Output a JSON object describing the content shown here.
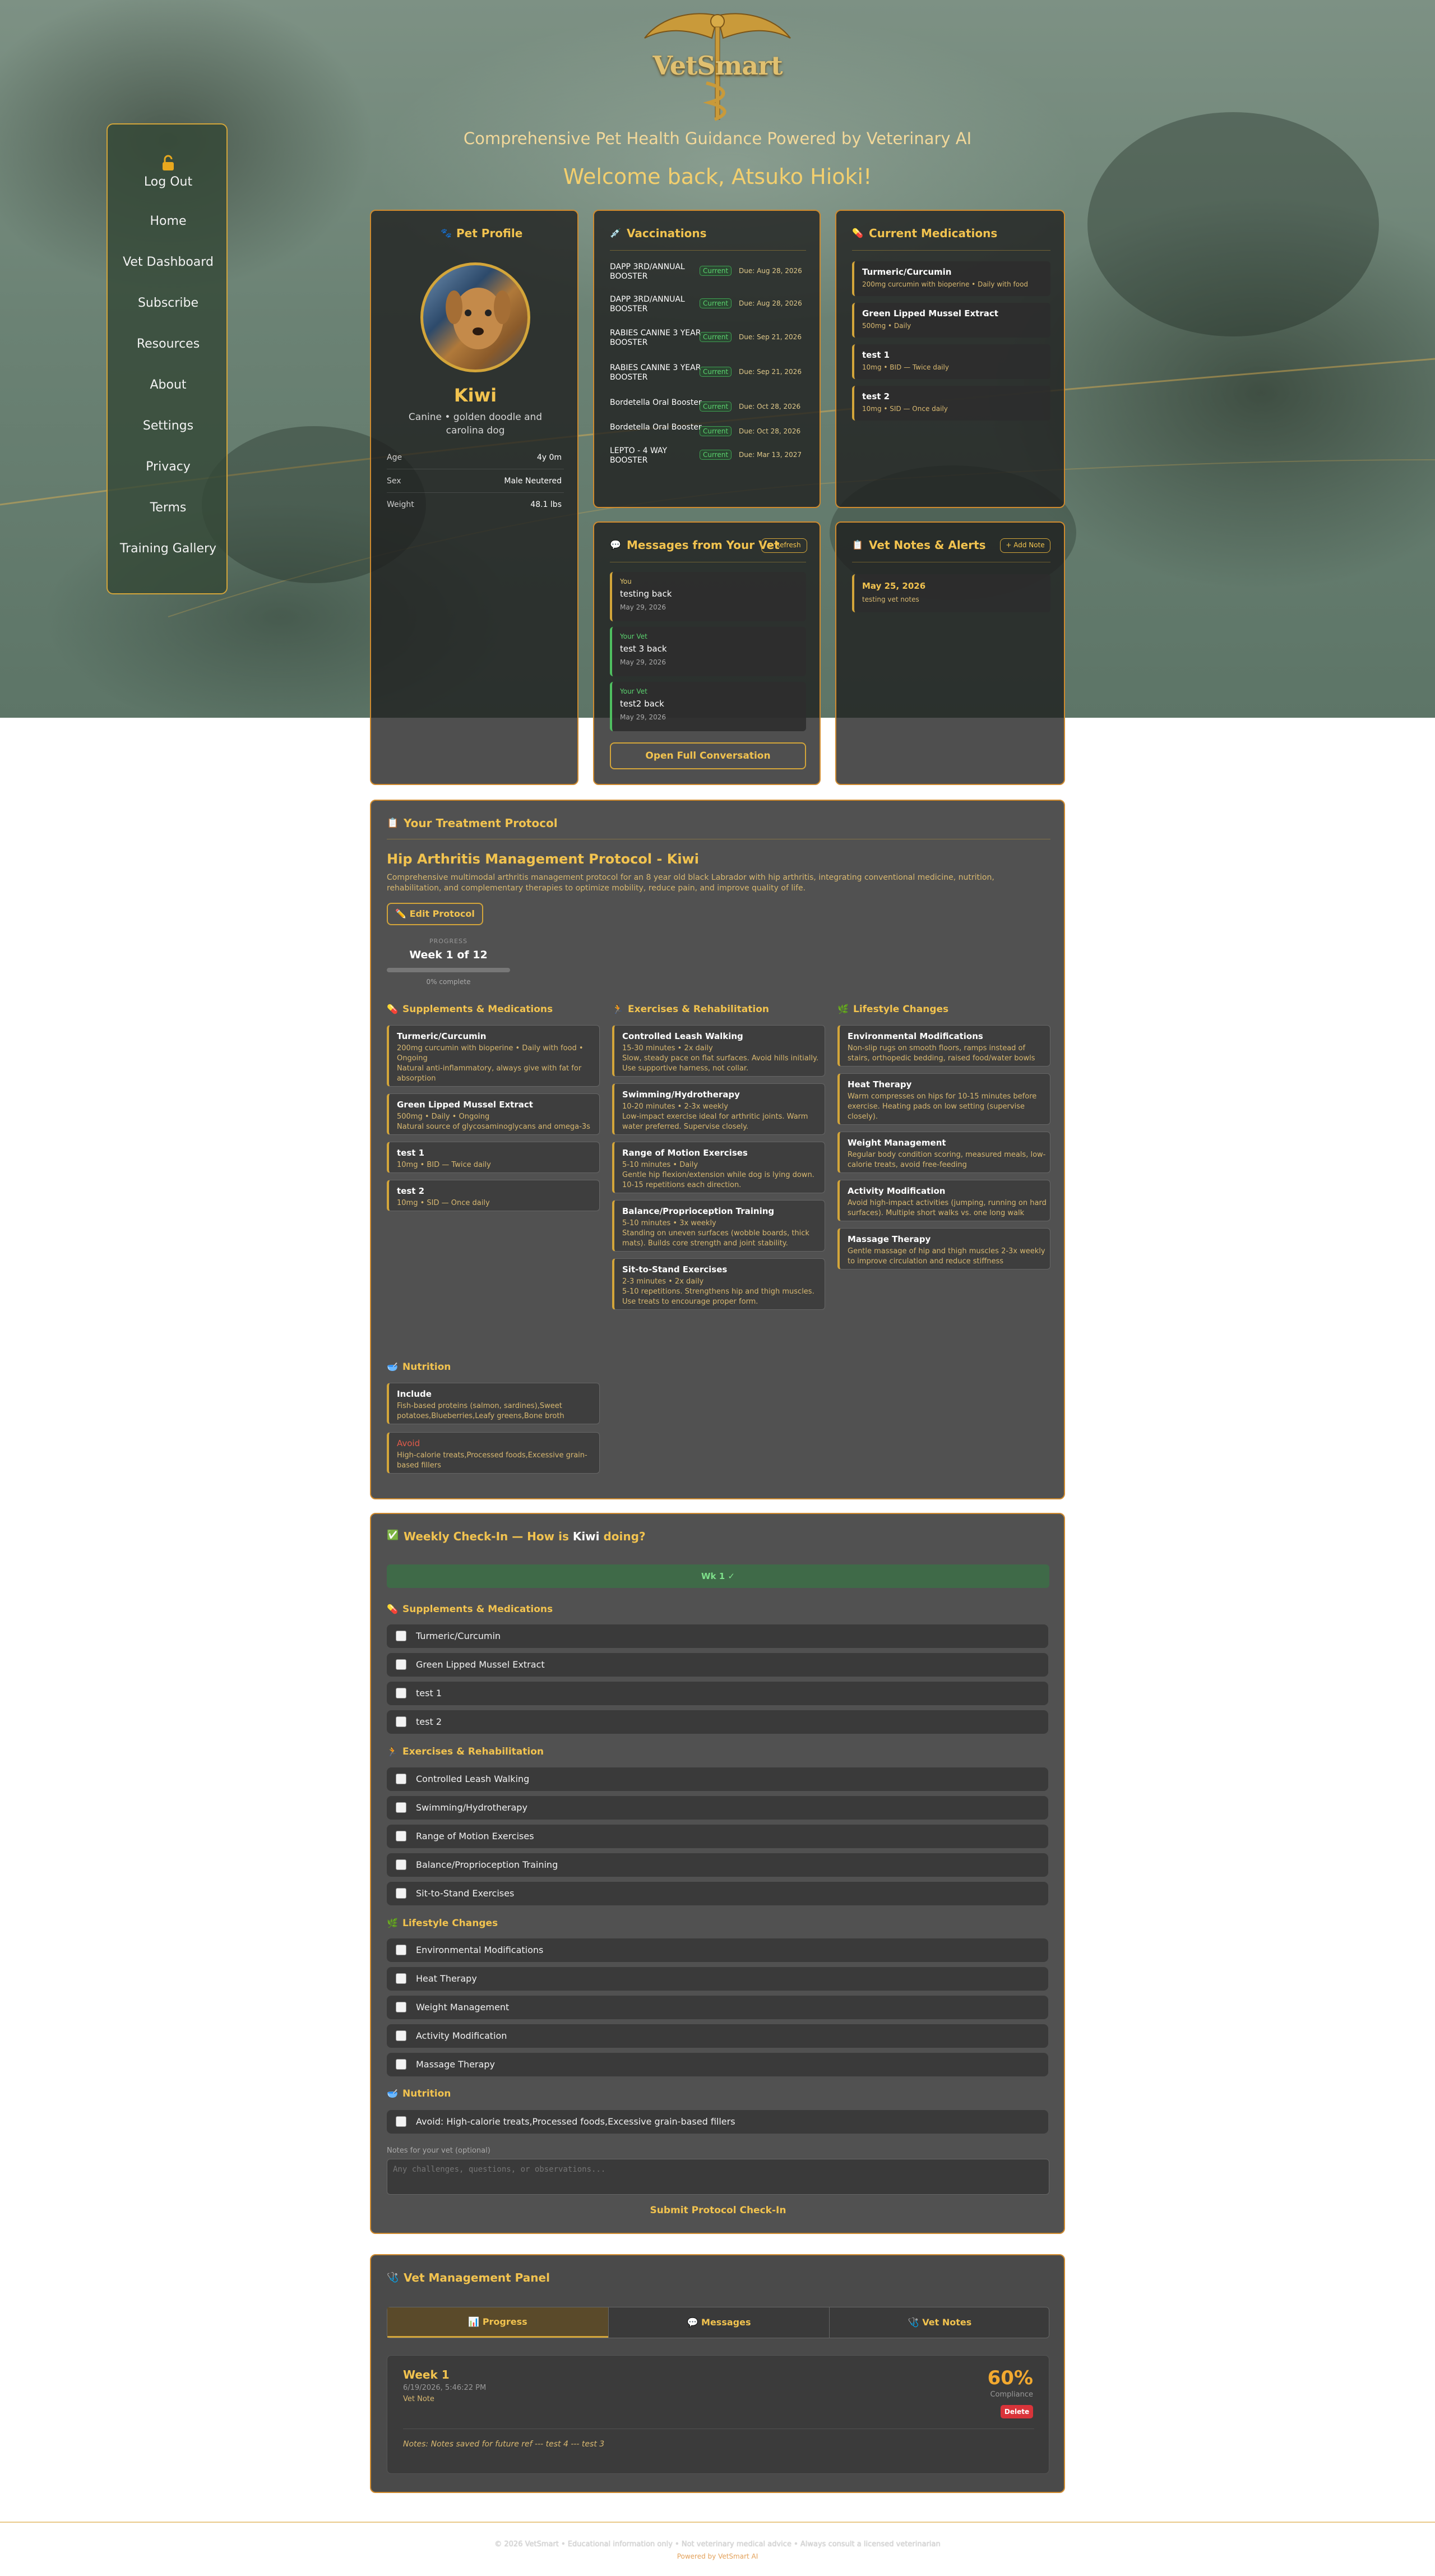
{
  "brand": {
    "name": "VetSmart",
    "tagline": "Comprehensive Pet Health Guidance Powered by Veterinary AI",
    "welcome": "Welcome back, Atsuko Hioki!"
  },
  "colors": {
    "gold": "#d3a53a",
    "card": "#515151",
    "green": "#4fbf60",
    "red": "#d9343a"
  },
  "sidebar": {
    "logout": "Log Out",
    "items": [
      "Home",
      "Vet Dashboard",
      "Subscribe",
      "Resources",
      "About",
      "Settings",
      "Privacy",
      "Terms",
      "Training Gallery"
    ]
  },
  "pet": {
    "heading": "Pet Profile",
    "name": "Kiwi",
    "breed": "Canine • golden doodle and carolina dog",
    "stats": [
      {
        "label": "Age",
        "value": "4y 0m"
      },
      {
        "label": "Sex",
        "value": "Male Neutered"
      },
      {
        "label": "Weight",
        "value": "48.1 lbs"
      }
    ]
  },
  "vaccinations": {
    "heading": "Vaccinations",
    "items": [
      {
        "name": "DAPP 3RD/ANNUAL BOOSTER",
        "status": "Current",
        "due": "Due: Aug 28, 2026"
      },
      {
        "name": "DAPP 3RD/ANNUAL BOOSTER",
        "status": "Current",
        "due": "Due: Aug 28, 2026"
      },
      {
        "name": "RABIES CANINE 3 YEAR BOOSTER",
        "status": "Current",
        "due": "Due: Sep 21, 2026"
      },
      {
        "name": "RABIES CANINE 3 YEAR BOOSTER",
        "status": "Current",
        "due": "Due: Sep 21, 2026"
      },
      {
        "name": "Bordetella Oral Booster",
        "status": "Current",
        "due": "Due: Oct 28, 2026"
      },
      {
        "name": "Bordetella Oral Booster",
        "status": "Current",
        "due": "Due: Oct 28, 2026"
      },
      {
        "name": "LEPTO - 4 WAY BOOSTER",
        "status": "Current",
        "due": "Due: Mar 13, 2027"
      }
    ]
  },
  "medications": {
    "heading": "Current Medications",
    "items": [
      {
        "name": "Turmeric/Curcumin",
        "detail": "200mg curcumin with bioperine • Daily with food"
      },
      {
        "name": "Green Lipped Mussel Extract",
        "detail": "500mg • Daily"
      },
      {
        "name": "test 1",
        "detail": "10mg • BID — Twice daily"
      },
      {
        "name": "test 2",
        "detail": "10mg • SID — Once daily"
      }
    ]
  },
  "messages": {
    "heading": "Messages from Your Vet",
    "refresh": "↻ Refresh",
    "open": "Open Full Conversation",
    "items": [
      {
        "from": "You",
        "text": "testing back",
        "date": "May 29, 2026"
      },
      {
        "from": "Your Vet",
        "text": "test 3 back",
        "date": "May 29, 2026"
      },
      {
        "from": "Your Vet",
        "text": "test2 back",
        "date": "May 29, 2026"
      }
    ]
  },
  "notes": {
    "heading": "Vet Notes & Alerts",
    "add": "+ Add Note",
    "items": [
      {
        "date": "May 25, 2026",
        "text": "testing vet notes"
      }
    ]
  },
  "protocol": {
    "heading": "Your Treatment Protocol",
    "title": "Hip Arthritis Management Protocol - Kiwi",
    "desc": "Comprehensive multimodal arthritis management protocol for an 8 year old black Labrador with hip arthritis, integrating conventional medicine, nutrition, rehabilitation, and complementary therapies to optimize mobility, reduce pain, and improve quality of life.",
    "edit": "Edit Protocol",
    "progress_label": "PROGRESS",
    "week": "Week 1 of 12",
    "complete": "0% complete",
    "progress_fraction": 0,
    "supp_h": "Supplements & Medications",
    "ex_h": "Exercises & Rehabilitation",
    "life_h": "Lifestyle Changes",
    "nut_h": "Nutrition",
    "supplements": [
      {
        "t": "Turmeric/Curcumin",
        "s": [
          "200mg curcumin with bioperine • Daily with food •",
          "Ongoing",
          "Natural anti-inflammatory, always give with fat for",
          "absorption"
        ]
      },
      {
        "t": "Green Lipped Mussel Extract",
        "s": [
          "500mg • Daily • Ongoing",
          "Natural source of glycosaminoglycans and omega-3s"
        ]
      },
      {
        "t": "test 1",
        "s": [
          "10mg • BID — Twice daily"
        ]
      },
      {
        "t": "test 2",
        "s": [
          "10mg • SID — Once daily"
        ]
      }
    ],
    "exercises": [
      {
        "t": "Controlled Leash Walking",
        "s": [
          "15-30 minutes • 2x daily",
          "Slow, steady pace on flat surfaces. Avoid hills initially.",
          "Use supportive harness, not collar."
        ]
      },
      {
        "t": "Swimming/Hydrotherapy",
        "s": [
          "10-20 minutes • 2-3x weekly",
          "Low-impact exercise ideal for arthritic joints. Warm",
          "water preferred. Supervise closely."
        ]
      },
      {
        "t": "Range of Motion Exercises",
        "s": [
          "5-10 minutes • Daily",
          "Gentle hip flexion/extension while dog is lying down.",
          "10-15 repetitions each direction."
        ]
      },
      {
        "t": "Balance/Proprioception Training",
        "s": [
          "5-10 minutes • 3x weekly",
          "Standing on uneven surfaces (wobble boards, thick",
          "mats). Builds core strength and joint stability."
        ]
      },
      {
        "t": "Sit-to-Stand Exercises",
        "s": [
          "2-3 minutes • 2x daily",
          "5-10 repetitions. Strengthens hip and thigh muscles.",
          "Use treats to encourage proper form."
        ]
      }
    ],
    "lifestyle": [
      {
        "t": "Environmental Modifications",
        "s": [
          "Non-slip rugs on smooth floors, ramps instead of",
          "stairs, orthopedic bedding, raised food/water bowls"
        ]
      },
      {
        "t": "Heat Therapy",
        "s": [
          "Warm compresses on hips for 10-15 minutes before",
          "exercise. Heating pads on low setting (supervise",
          "closely)."
        ]
      },
      {
        "t": "Weight Management",
        "s": [
          "Regular body condition scoring, measured meals, low-",
          "calorie treats, avoid free-feeding"
        ]
      },
      {
        "t": "Activity Modification",
        "s": [
          "Avoid high-impact activities (jumping, running on hard",
          "surfaces). Multiple short walks vs. one long walk"
        ]
      },
      {
        "t": "Massage Therapy",
        "s": [
          "Gentle massage of hip and thigh muscles 2-3x weekly",
          "to improve circulation and reduce stiffness"
        ]
      }
    ],
    "nutrition": [
      {
        "t": "Include",
        "s": [
          "Fish-based proteins (salmon, sardines),Sweet",
          "potatoes,Blueberries,Leafy greens,Bone broth"
        ]
      },
      {
        "t": "Avoid",
        "s": [
          "High-calorie treats,Processed foods,Excessive grain-",
          "based fillers"
        ]
      }
    ]
  },
  "checkin": {
    "heading_pre": "Weekly Check-In — How is",
    "pet": "Kiwi",
    "heading_post": "doing?",
    "week_btn": "Wk 1 ✓",
    "supp_h": "Supplements & Medications",
    "ex_h": "Exercises & Rehabilitation",
    "life_h": "Lifestyle Changes",
    "nut_h": "Nutrition",
    "supp": [
      "Turmeric/Curcumin",
      "Green Lipped Mussel Extract",
      "test 1",
      "test 2"
    ],
    "ex": [
      "Controlled Leash Walking",
      "Swimming/Hydrotherapy",
      "Range of Motion Exercises",
      "Balance/Proprioception Training",
      "Sit-to-Stand Exercises"
    ],
    "life": [
      "Environmental Modifications",
      "Heat Therapy",
      "Weight Management",
      "Activity Modification",
      "Massage Therapy"
    ],
    "nut": [
      "Avoid: High-calorie treats,Processed foods,Excessive grain-based fillers"
    ],
    "notes_label": "Notes for your vet (optional)",
    "notes_placeholder": "Any challenges, questions, or observations...",
    "submit": "Submit Protocol Check-In"
  },
  "vetpanel": {
    "heading": "Vet Management Panel",
    "tabs": [
      "Progress",
      "Messages",
      "Vet Notes"
    ],
    "entry": {
      "week": "Week 1",
      "datetime": "6/19/2026, 5:46:22 PM",
      "note_label": "Vet Note",
      "compliance": "60%",
      "compliance_label": "Compliance",
      "delete": "Delete",
      "notes": "Notes: Notes saved for future ref --- test 4 --- test 3"
    }
  },
  "footer": {
    "line1": "© 2026 VetSmart • Educational information only • Not veterinary medical advice • Always consult a licensed veterinarian",
    "line2": "Powered by VetSmart AI"
  }
}
